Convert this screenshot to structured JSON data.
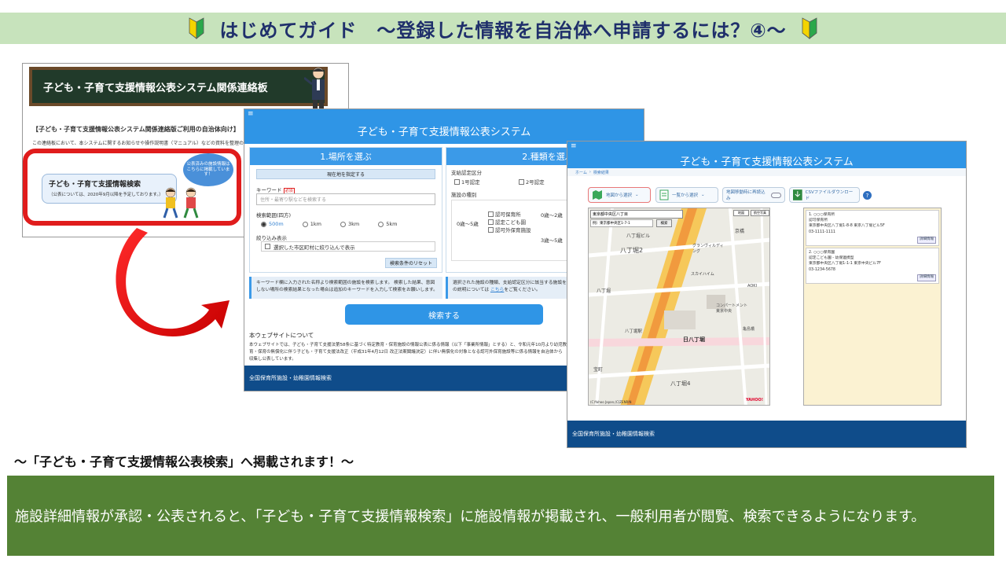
{
  "title": {
    "text": "はじめてガイド　～登録した情報を自治体へ申請するには？④～"
  },
  "bulletin": {
    "board_title": "子ども・子育て支援情報公表システム関係連絡板",
    "heading": "【子ども・子育て支援情報公表システム関係連絡版ご利用の自治体向け】",
    "note": "この連絡板において、本システムに関するお知らせや操作説明書（マニュアル）などの資料を整理の予",
    "card_title": "子ども・子育て支援情報検索",
    "card_sub": "（公表については、2020年9月以降を予定しております。）",
    "bubble": "公表済みの施設情報はこちらに掲載しています！"
  },
  "search_screen": {
    "menu_icon": "≡",
    "system_title": "子ども・子育て支援情報公表システム",
    "panel1_title": "1.場所を選ぶ",
    "current_location_button": "現在地を指定する",
    "keyword_label": "キーワード",
    "keyword_required": "必須",
    "keyword_placeholder": "住所・最寄り駅などを検索する",
    "range_label": "検索範囲(四方)",
    "ranges": [
      "500m",
      "1km",
      "3km",
      "5km"
    ],
    "narrow_label": "絞り込み表示",
    "narrow_option": "選択した市区町村に絞り込んで表示",
    "reset_button": "検索条件のリセット",
    "info1": "キーワード欄に入力された名称より検索範囲の施設を検索します。 検索した結果、意図しない場所の検索結果となった場合は追加のキーワードを入力して検索をお願いします。",
    "panel2_title": "2.種類を選ぶ",
    "cert_label": "支給認定区分",
    "cert1": "1号認定",
    "cert2": "2号認定",
    "facility_type_label": "施設の種別",
    "age_range1": "0歳～5歳",
    "age_range2": "0歳～2歳",
    "age_range3": "3歳～5歳",
    "type1": "認可保育所",
    "type2": "認定こども園",
    "type3": "認可外保育施設",
    "info2_a": "選択された施設の種類、支給認定区分に該当する施設を検索します。",
    "info2_b": "の説明については",
    "info2_link": "こちら",
    "info2_c": "をご覧ください。",
    "search_button": "検索する",
    "about_title": "本ウェブサイトについて",
    "about_text": "本ウェブサイトでは、子ども・子育て支援法第58条に基づく特定教育・保育施設の情報公表に係る情報（以下「事業所情報」とする）と、令和元年10月より幼児教育・保育の無償化に伴う子ども・子育て支援法改正（平成31年4月12日 改正法案閣議決定）に伴い無償化の対象となる認可外保育施設等に係る情報を自治体から収集し公表しています。",
    "footer": "全国保育所施設・幼稚園情報検索"
  },
  "map_screen": {
    "menu_icon": "≡",
    "system_title": "子ども・子育て支援情報公表システム",
    "breadcrumb_home": "ホーム",
    "breadcrumb_current": "検索結果",
    "map_select_button": "地図から選択",
    "list_select_button": "一覧から選択",
    "map_link_button": "地図移動時に再読込み",
    "csv_button": "CSVファイルダウンロード",
    "help_icon": "?",
    "map_tab1": "地図",
    "map_tab2": "航空写真",
    "map_address": "東京都中央区八丁目",
    "map_search_value": "例）東京都中央区1-7-1",
    "map_search_button": "検索",
    "map_labels": [
      "八丁堀ビル",
      "八丁堀2",
      "八丁堀",
      "八丁堀駅",
      "京橋",
      "日八丁堀",
      "八丁堀4",
      "宝町",
      "スカイハイム",
      "コンパートメント東京中央",
      "グランヴィルディング",
      "亀島橋",
      "AOKI"
    ],
    "map_banner": "日八丁堀",
    "map_copyright": "(C)Yahoo Japan,(C)ZENRIN",
    "yahoo_logo": "YAHOO!",
    "results": [
      {
        "name": "1. ○○○保育所",
        "type": "認可保育所",
        "address": "東京都中央区八丁堀1-8-8 東京八丁堀ビル5F",
        "tel": "03-1111-1111",
        "detail": "詳細情報"
      },
      {
        "name": "2. ○○○保育園",
        "type": "認定こども園 - 幼保連携型",
        "address": "東京都中央区八丁堀1-1-1 東京中央ビル7F",
        "tel": "03-1234-5678",
        "detail": "詳細情報"
      }
    ],
    "footer": "全国保育所施設・幼稚園情報検索"
  },
  "caption": "～「子ども・子育て支援情報公表検索」へ掲載されます！～",
  "description": "施設詳細情報が承認・公表されると、「子ども・子育て支援情報検索」に施設情報が掲載され、一般利用者が閲覧、検索できるようになります。",
  "colors": {
    "title_bar": "#c7e3bc",
    "title_text": "#1f2f6b",
    "system_blue": "#2f95e6",
    "footer_navy": "#0f4c8a",
    "alert_red": "#e01c1c",
    "description_green": "#548235"
  }
}
